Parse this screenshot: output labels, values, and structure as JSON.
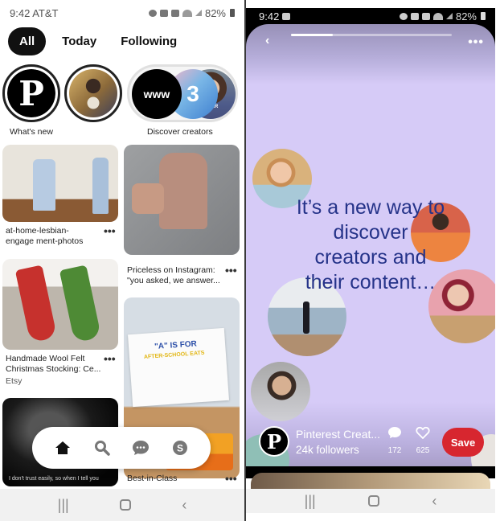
{
  "left_screen": {
    "status_bar": {
      "time": "9:42",
      "carrier": "AT&T",
      "battery": "82%"
    },
    "tabs": [
      {
        "label": "All",
        "active": true
      },
      {
        "label": "Today",
        "active": false
      },
      {
        "label": "Following",
        "active": false
      }
    ],
    "stories": [
      {
        "label": "What's new",
        "icon": "pinterest-logo"
      },
      {
        "label": "",
        "icon": "profile-photo"
      },
      {
        "label": "Discover creators",
        "icon": "creators-group",
        "badge_text": "www",
        "blogger_text": "BLOGGER"
      }
    ],
    "pins": [
      {
        "title": "at-home-lesbian-engage ment-photos",
        "column": "left"
      },
      {
        "title": "Priceless on Instagram: \"you asked, we answer...",
        "column": "right"
      },
      {
        "title": "Handmade Wool Felt Christmas Stocking: Ce...",
        "subtitle": "Etsy",
        "column": "left"
      },
      {
        "title": "Best-in-Class",
        "column": "right",
        "image_text_1": "\"A\" IS FOR",
        "image_text_2": "AFTER-SCHOOL EATS"
      },
      {
        "title": "",
        "column": "left",
        "image_caption": "I don't trust easily, so when I tell you"
      }
    ],
    "more_label": "•••",
    "bottom_nav": [
      {
        "name": "home",
        "active": true
      },
      {
        "name": "search",
        "active": false
      },
      {
        "name": "messages",
        "active": false
      },
      {
        "name": "profile",
        "active": false,
        "initial": "S"
      }
    ],
    "system_nav": {
      "recent": "|||",
      "back": "‹"
    }
  },
  "right_screen": {
    "status_bar": {
      "time": "9:42",
      "battery": "82%"
    },
    "story_progress": 0.26,
    "back_label": "‹",
    "more_label": "•••",
    "headline": "It’s a new way to discover creators and their content…",
    "creator": {
      "name": "Pinterest Creat...",
      "followers": "24k followers",
      "comments": "172",
      "likes": "625"
    },
    "save_label": "Save",
    "colors": {
      "background": "#d6cbf7",
      "headline": "#253389",
      "save": "#d7262f"
    },
    "system_nav": {
      "recent": "|||",
      "back": "‹"
    }
  }
}
